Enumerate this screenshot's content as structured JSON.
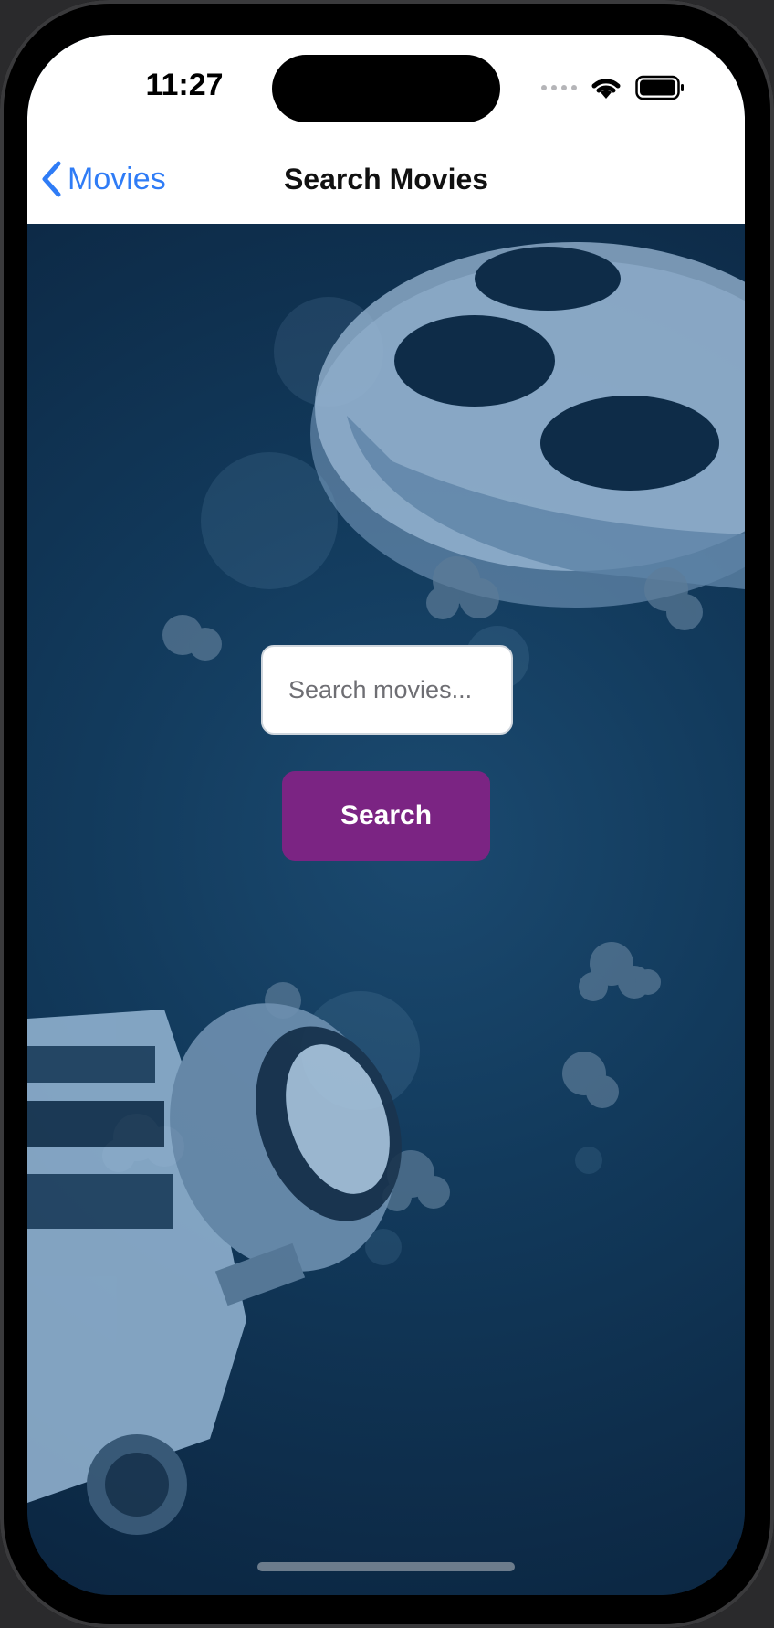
{
  "status_bar": {
    "time": "11:27",
    "icons": [
      "signal-dots-icon",
      "wifi-icon",
      "battery-icon"
    ]
  },
  "nav": {
    "back_label": "Movies",
    "back_icon": "chevron-left-icon",
    "title": "Search Movies"
  },
  "search": {
    "placeholder": "Search movies...",
    "value": "",
    "button_label": "Search"
  },
  "colors": {
    "accent": "#2f7cf6",
    "button": "#7b2483",
    "background": "#123a5c"
  }
}
